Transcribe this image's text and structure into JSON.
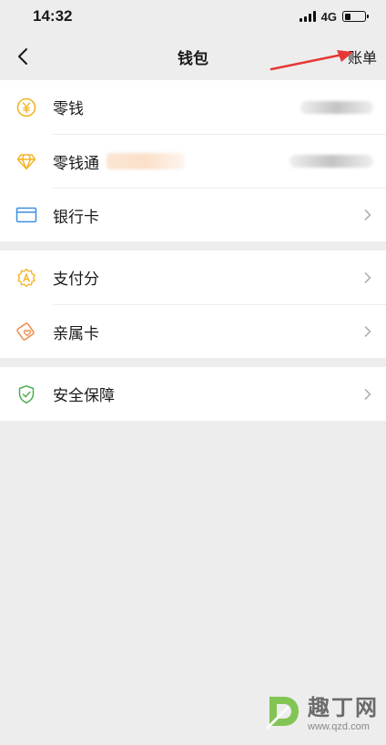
{
  "status_bar": {
    "time": "14:32",
    "network": "4G"
  },
  "nav": {
    "title": "钱包",
    "right_label": "账单"
  },
  "groups": [
    {
      "items": [
        {
          "label": "零钱",
          "icon": "yuan-coin-icon"
        },
        {
          "label": "零钱通",
          "icon": "diamond-icon"
        },
        {
          "label": "银行卡",
          "icon": "bank-card-icon"
        }
      ]
    },
    {
      "items": [
        {
          "label": "支付分",
          "icon": "pay-score-icon"
        },
        {
          "label": "亲属卡",
          "icon": "family-card-icon"
        }
      ]
    },
    {
      "items": [
        {
          "label": "安全保障",
          "icon": "shield-check-icon"
        }
      ]
    }
  ],
  "watermark": {
    "text": "趣丁网",
    "url": "www.qzd.com"
  },
  "colors": {
    "background": "#ededed",
    "card": "#ffffff",
    "accent_yellow": "#f5b324",
    "accent_blue": "#3d8fe0",
    "accent_orange": "#f08a4b",
    "accent_green": "#4caf50",
    "annotation_red": "#e53935"
  }
}
